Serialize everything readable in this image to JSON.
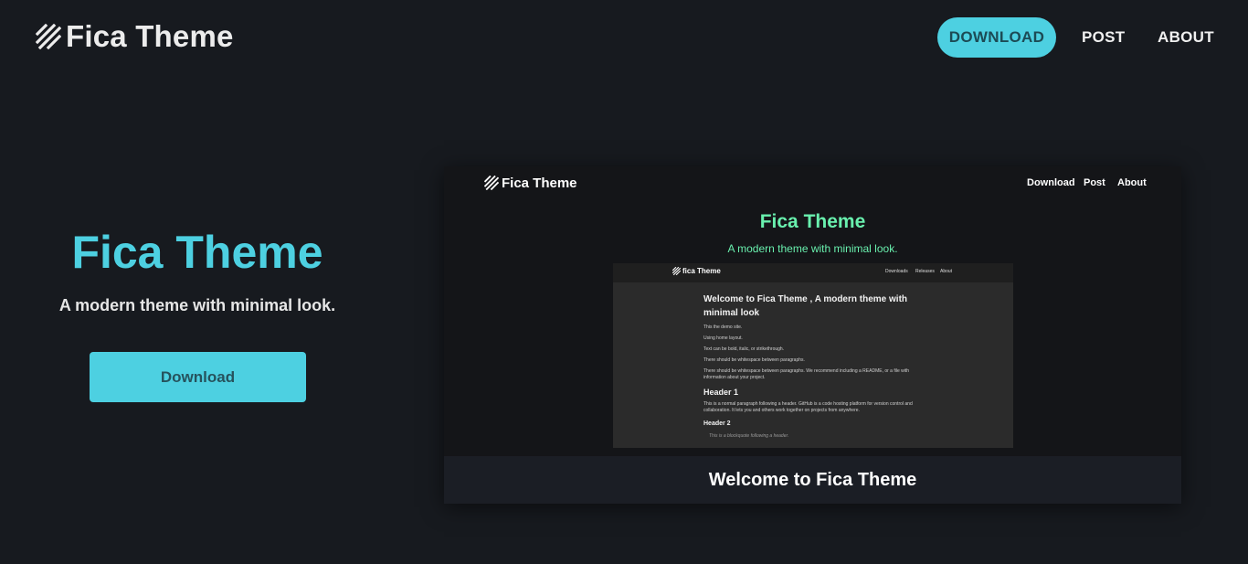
{
  "header": {
    "brand": "Fica Theme",
    "nav": {
      "download": "DOWNLOAD",
      "post": "POST",
      "about": "ABOUT"
    }
  },
  "hero": {
    "title": "Fica Theme",
    "subtitle": "A modern theme with minimal look.",
    "button": "Download"
  },
  "preview": {
    "brand": "Fica Theme",
    "nav": {
      "download": "Download",
      "post": "Post",
      "about": "About"
    },
    "title": "Fica Theme",
    "subtitle": "A modern theme with minimal look.",
    "nested": {
      "brand": "fica Theme",
      "links": [
        "Downloads",
        "Releases",
        "About"
      ],
      "heading": "Welcome to Fica Theme , A modern theme with minimal look",
      "paragraphs": [
        "This the demo site.",
        "Using home layout.",
        "Text can be bold, italic, or strikethrough.",
        "There should be whitespace between paragraphs.",
        "There should be whitespace between paragraphs. We recommend including a README, or a file with information about your project."
      ],
      "header1": "Header 1",
      "header1_text": "This is a normal paragraph following a header. GitHub is a code hosting platform for version control and collaboration. It lets you and others work together on projects from anywhere.",
      "header2": "Header 2",
      "blockquote": "This is a blockquote following a header."
    },
    "footer_title": "Welcome to Fica Theme"
  },
  "colors": {
    "background": "#171a1f",
    "accent": "#4dd0e1",
    "preview_accent": "#69f0ae"
  },
  "icons": {
    "logo": "diagonal-stripes-logo-icon"
  }
}
